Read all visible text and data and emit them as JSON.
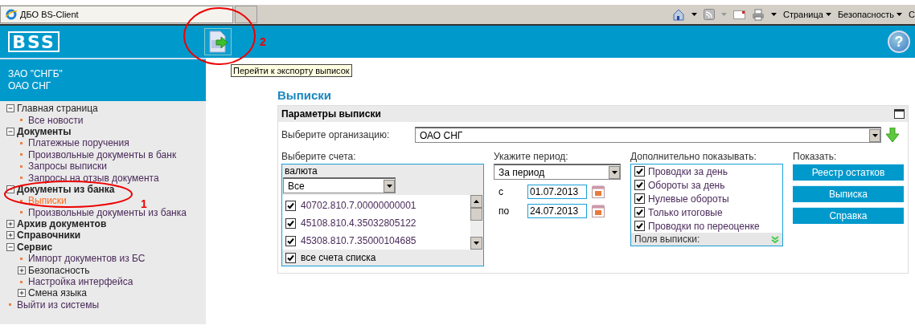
{
  "browser": {
    "tab": "ДБО BS-Client",
    "commands": [
      "Страница",
      "Безопасность",
      "С"
    ]
  },
  "header": {
    "logo": "BSS",
    "help": "?",
    "export_tooltip": "Перейти к экспорту выписок"
  },
  "org_block": {
    "lines": [
      "ЗАО \"СНГБ\"",
      "ОАО СНГ"
    ]
  },
  "sidebar": {
    "menu": [
      {
        "kind": "group",
        "label": "Главная страница",
        "bold": false,
        "expanded": true,
        "children": [
          {
            "kind": "link",
            "label": "Все новости",
            "selected": false
          }
        ]
      },
      {
        "kind": "group",
        "label": "Документы",
        "bold": true,
        "expanded": true,
        "children": [
          {
            "kind": "link",
            "label": "Платежные поручения",
            "selected": false
          },
          {
            "kind": "link",
            "label": "Произвольные документы в банк",
            "selected": false
          },
          {
            "kind": "link",
            "label": "Запросы выписки",
            "selected": false
          },
          {
            "kind": "link",
            "label": "Запросы на отзыв документа",
            "selected": false
          }
        ]
      },
      {
        "kind": "group",
        "label": "Документы из банка",
        "bold": true,
        "expanded": true,
        "children": [
          {
            "kind": "link",
            "label": "Выписки",
            "selected": true
          },
          {
            "kind": "link",
            "label": "Произвольные документы из банка",
            "selected": false
          }
        ]
      },
      {
        "kind": "group",
        "label": "Архив документов",
        "bold": true,
        "expanded": false
      },
      {
        "kind": "group",
        "label": "Справочники",
        "bold": true,
        "expanded": false
      },
      {
        "kind": "group",
        "label": "Сервис",
        "bold": true,
        "expanded": true,
        "children": [
          {
            "kind": "link",
            "label": "Импорт документов из БС",
            "selected": false
          },
          {
            "kind": "group",
            "label": "Безопасность",
            "bold": false,
            "expanded": false
          },
          {
            "kind": "link",
            "label": "Настройка интерфейса",
            "selected": false
          },
          {
            "kind": "group",
            "label": "Смена языка",
            "bold": false,
            "expanded": false
          }
        ]
      },
      {
        "kind": "link",
        "label": "Выйти из системы",
        "selected": false
      }
    ]
  },
  "page_title": "Выписки",
  "panel": {
    "title": "Параметры выписки",
    "org_label": "Выберите организацию:",
    "org_value": "ОАО СНГ",
    "accounts": {
      "label": "Выберите счета:",
      "currency_label": "валюта",
      "currency_value": "Все",
      "items": [
        {
          "label": "40702.810.7.00000000001",
          "checked": true
        },
        {
          "label": "45108.810.4.35032805122",
          "checked": true
        },
        {
          "label": "45308.810.7.35000104685",
          "checked": true
        }
      ],
      "all": {
        "label": "все счета списка",
        "checked": true
      }
    },
    "period": {
      "label": "Укажите период:",
      "value": "За период",
      "from_label": "с",
      "from": "01.07.2013",
      "to_label": "по",
      "to": "24.07.2013"
    },
    "extra": {
      "label": "Дополнительно показывать:",
      "options": [
        {
          "label": "Проводки за день",
          "checked": true
        },
        {
          "label": "Обороты за день",
          "checked": true
        },
        {
          "label": "Нулевые обороты",
          "checked": true
        },
        {
          "label": "Только итоговые",
          "checked": true
        },
        {
          "label": "Проводки по переоценке",
          "checked": true
        }
      ],
      "fields_label": "Поля выписки:"
    },
    "show": {
      "label": "Показать:",
      "buttons": [
        "Реестр остатков",
        "Выписка",
        "Справка"
      ]
    }
  },
  "annotations": [
    {
      "label": "2"
    },
    {
      "label": "1"
    }
  ]
}
